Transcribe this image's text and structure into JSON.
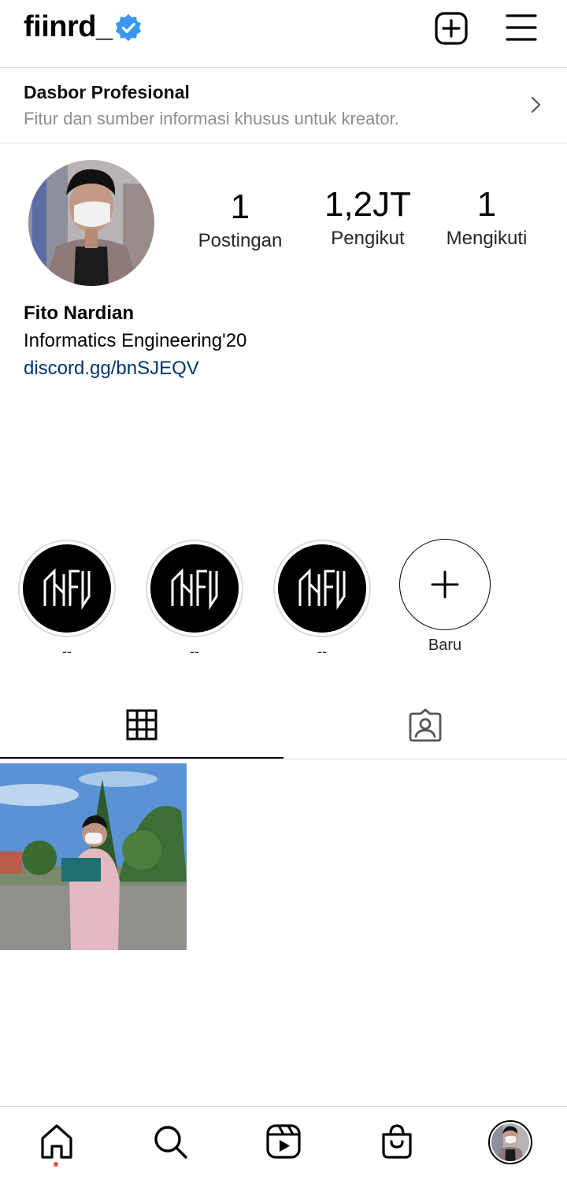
{
  "header": {
    "username": "fiinrd_",
    "verified_icon": "verified-badge-icon",
    "new_post_icon": "plus-square-icon",
    "menu_icon": "hamburger-menu-icon"
  },
  "dashboard": {
    "title": "Dasbor Profesional",
    "subtitle": "Fitur dan sumber informasi khusus untuk kreator."
  },
  "stats": [
    {
      "value": "1",
      "label": "Postingan"
    },
    {
      "value": "1,2JT",
      "label": "Pengikut"
    },
    {
      "value": "1",
      "label": "Mengikuti"
    }
  ],
  "bio": {
    "full_name": "Fito Nardian",
    "text": "Informatics Engineering'20",
    "link": "discord.gg/bnSJEQV"
  },
  "highlights": [
    {
      "label": "--"
    },
    {
      "label": "--"
    },
    {
      "label": "--"
    },
    {
      "label": "Baru"
    }
  ],
  "tabs": {
    "grid_icon": "grid-icon",
    "tagged_icon": "tagged-person-icon"
  },
  "nav": {
    "items": [
      "home-icon",
      "search-icon",
      "reels-icon",
      "shop-icon",
      "profile-avatar"
    ]
  },
  "colors": {
    "link": "#00376b",
    "verified": "#3897f0",
    "notification_dot": "#ed4956"
  }
}
